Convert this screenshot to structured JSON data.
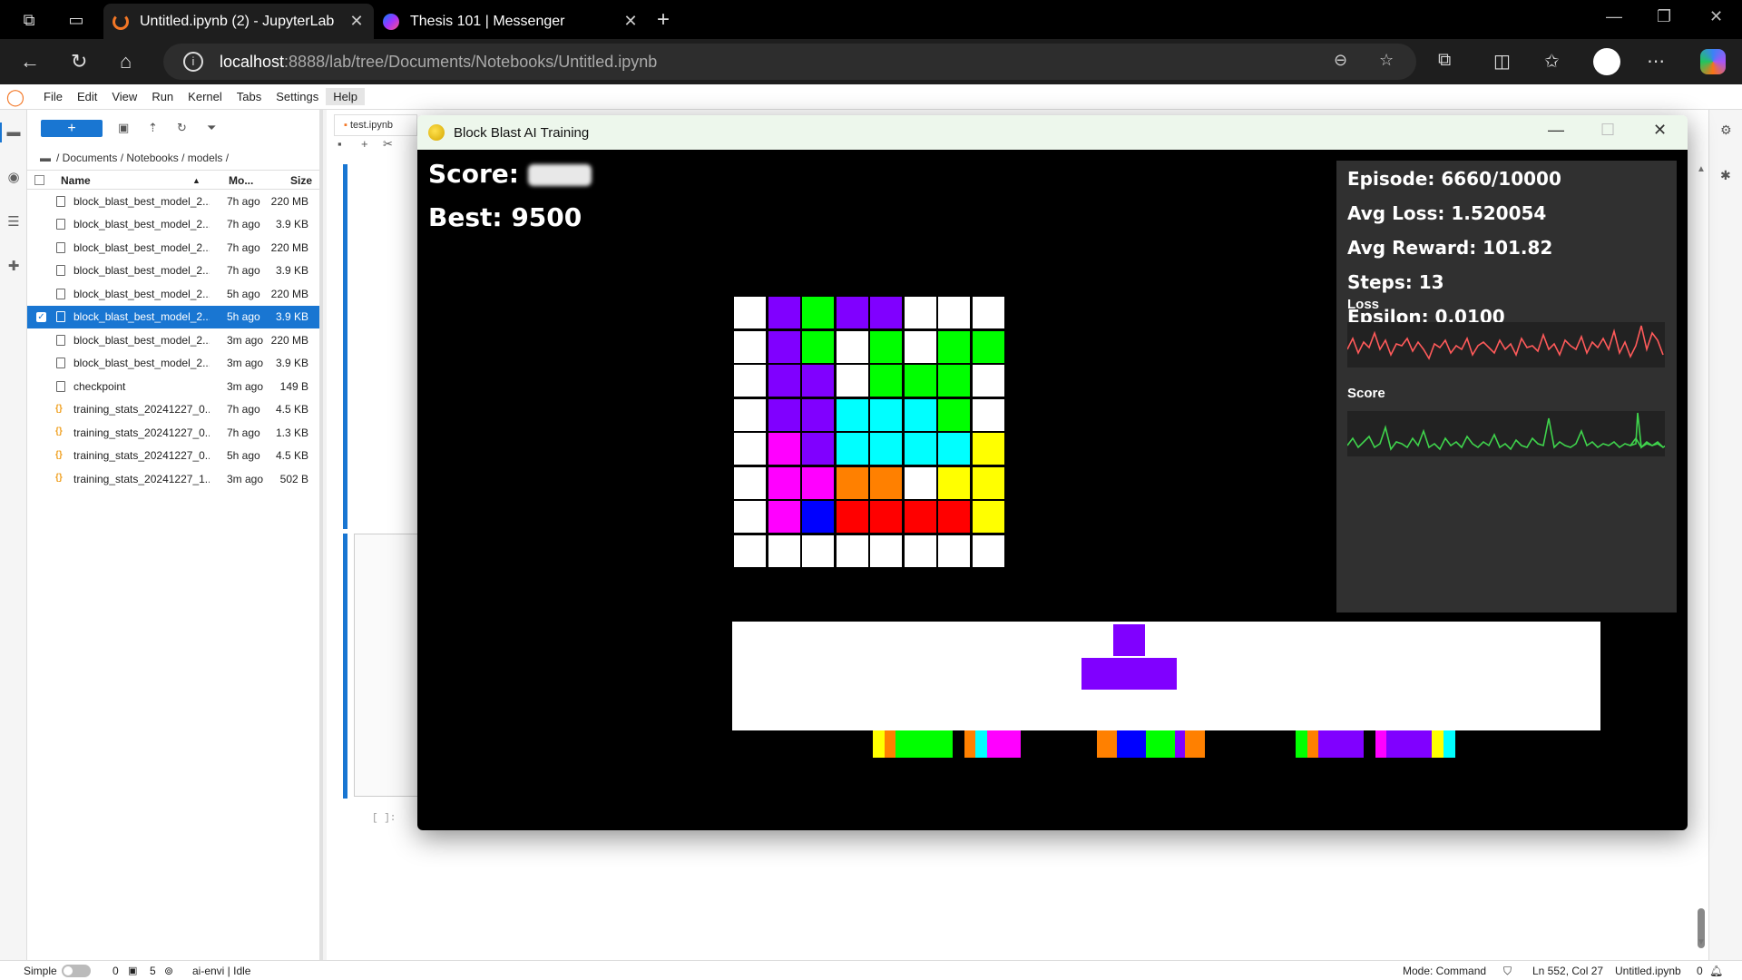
{
  "browser": {
    "tabs": [
      {
        "title": "Untitled.ipynb (2) - JupyterLab",
        "active": true
      },
      {
        "title": "Thesis 101 | Messenger",
        "active": false
      }
    ],
    "address": {
      "host": "localhost",
      "path": ":8888/lab/tree/Documents/Notebooks/Untitled.ipynb"
    }
  },
  "jupyter": {
    "menus": [
      "File",
      "Edit",
      "View",
      "Run",
      "Kernel",
      "Tabs",
      "Settings",
      "Help"
    ],
    "new_button": "+",
    "breadcrumb": "/ Documents / Notebooks / models /",
    "columns": {
      "name": "Name",
      "modified": "Mo...",
      "size": "Size"
    },
    "files": [
      {
        "name": "block_blast_best_model_2...",
        "modified": "7h ago",
        "size": "220 MB",
        "type": "file",
        "selected": false
      },
      {
        "name": "block_blast_best_model_2...",
        "modified": "7h ago",
        "size": "3.9 KB",
        "type": "file",
        "selected": false
      },
      {
        "name": "block_blast_best_model_2...",
        "modified": "7h ago",
        "size": "220 MB",
        "type": "file",
        "selected": false
      },
      {
        "name": "block_blast_best_model_2...",
        "modified": "7h ago",
        "size": "3.9 KB",
        "type": "file",
        "selected": false
      },
      {
        "name": "block_blast_best_model_2...",
        "modified": "5h ago",
        "size": "220 MB",
        "type": "file",
        "selected": false
      },
      {
        "name": "block_blast_best_model_2...",
        "modified": "5h ago",
        "size": "3.9 KB",
        "type": "file",
        "selected": true
      },
      {
        "name": "block_blast_best_model_2...",
        "modified": "3m ago",
        "size": "220 MB",
        "type": "file",
        "selected": false
      },
      {
        "name": "block_blast_best_model_2...",
        "modified": "3m ago",
        "size": "3.9 KB",
        "type": "file",
        "selected": false
      },
      {
        "name": "checkpoint",
        "modified": "3m ago",
        "size": "149 B",
        "type": "file",
        "selected": false
      },
      {
        "name": "training_stats_20241227_0...",
        "modified": "7h ago",
        "size": "4.5 KB",
        "type": "json",
        "selected": false
      },
      {
        "name": "training_stats_20241227_0...",
        "modified": "7h ago",
        "size": "1.3 KB",
        "type": "json",
        "selected": false
      },
      {
        "name": "training_stats_20241227_0...",
        "modified": "5h ago",
        "size": "4.5 KB",
        "type": "json",
        "selected": false
      },
      {
        "name": "training_stats_20241227_1...",
        "modified": "3m ago",
        "size": "502 B",
        "type": "json",
        "selected": false
      }
    ],
    "doc_tab": "test.ipynb",
    "prompt": "[ ]:",
    "status": {
      "mode_label": "Simple",
      "count_a": "0",
      "count_b": "5",
      "kernel": "ai-envi | Idle",
      "mode": "Mode: Command",
      "cursor": "Ln 552, Col 27",
      "file": "Untitled.ipynb",
      "notifications": "0"
    }
  },
  "game": {
    "window_title": "Block Blast AI Training",
    "score_label": "Score:",
    "best": "Best: 9500",
    "stats": {
      "episode": "Episode: 6660/10000",
      "avg_loss": "Avg Loss: 1.520054",
      "avg_reward": "Avg Reward: 101.82",
      "steps": "Steps: 13",
      "epsilon": "Epsilon: 0.0100"
    },
    "plot_labels": {
      "loss": "Loss",
      "score": "Score"
    },
    "colors": {
      "W": "#ffffff",
      "P": "#8000ff",
      "G": "#00ff00",
      "C": "#00ffff",
      "M": "#ff00ff",
      "Y": "#ffff00",
      "O": "#ff8000",
      "B": "#0000ff",
      "R": "#ff0000"
    },
    "board": [
      "WPGPPWWW",
      "WPGWGWGG",
      "WPPWGGGW",
      "WPPCCCGW",
      "WMPCCCCY",
      "WMMOOWYY",
      "WMBRRRRY",
      "WWWWWWWW"
    ],
    "next_piece": {
      "shape": "T",
      "color": "#8000ff"
    },
    "history_strips": [
      [
        "Y",
        "O",
        "G",
        "G",
        "G",
        "G",
        "G",
        "W",
        "O",
        "C",
        "M",
        "M",
        "M",
        "W"
      ],
      [
        "O",
        "O",
        "B",
        "B",
        "B",
        "G",
        "G",
        "G",
        "P",
        "O",
        "O",
        "W",
        "W",
        "W"
      ],
      [
        "G",
        "O",
        "P",
        "P",
        "P",
        "P",
        "W",
        "M",
        "P",
        "P",
        "P",
        "P",
        "Y",
        "C"
      ]
    ]
  }
}
